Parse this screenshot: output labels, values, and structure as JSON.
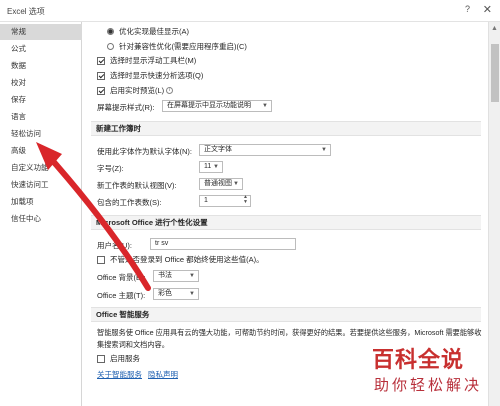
{
  "window": {
    "title": "Excel 选项",
    "help_icon": "?",
    "close_icon": "✕"
  },
  "sidebar": {
    "items": [
      {
        "label": "常规",
        "active": true
      },
      {
        "label": "公式"
      },
      {
        "label": "数据"
      },
      {
        "label": "校对"
      },
      {
        "label": "保存"
      },
      {
        "label": "语言"
      },
      {
        "label": "轻松访问"
      },
      {
        "label": "高级"
      },
      {
        "label": "自定义功能"
      },
      {
        "label": "快速访问工"
      },
      {
        "label": "加载项"
      },
      {
        "label": "信任中心"
      }
    ]
  },
  "ui_options": {
    "radio_optimize_display": "优化实现最佳显示(A)",
    "radio_compat": "针对兼容性优化(需要应用程序重启)(C)",
    "check_minitoolbar": "选择时显示浮动工具栏(M)",
    "check_quick_analysis": "选择时显示快速分析选项(Q)",
    "check_live_preview": "启用实时预览(L)",
    "tooltip_label": "屏幕提示样式(R):",
    "tooltip_value": "在屏幕提示中显示功能说明"
  },
  "new_workbook": {
    "header": "新建工作簿时",
    "font_label": "使用此字体作为默认字体(N):",
    "font_value": "正文字体",
    "size_label": "字号(Z):",
    "size_value": "11",
    "view_label": "新工作表的默认视图(V):",
    "view_value": "普通视图",
    "sheets_label": "包含的工作表数(S):",
    "sheets_value": "1"
  },
  "personalize": {
    "header": "Microsoft Office 进行个性化设置",
    "username_label": "用户名(U):",
    "username_value": "tr sv",
    "always_use_label": "不管是否登录到 Office 都始终使用这些值(A)。",
    "background_label": "Office 背景(B):",
    "background_value": "书法",
    "theme_label": "Office 主题(T):",
    "theme_value": "彩色"
  },
  "intelligent": {
    "header": "Office 智能服务",
    "desc": "智能服务使 Office 应用具有云的强大功能，可帮助节约时间，获得更好的结果。若要提供这些服务，Microsoft 需要能够收集搜索词和文档内容。",
    "enable_label": "启用服务",
    "about_link": "关于智能服务",
    "privacy_link": "隐私声明"
  },
  "watermark": {
    "line1": "百科全说",
    "line2": "助你轻松解决"
  },
  "colors": {
    "arrow": "#d9262a",
    "link": "#1d5fb0",
    "sidebar_active": "#d9d9d9"
  }
}
